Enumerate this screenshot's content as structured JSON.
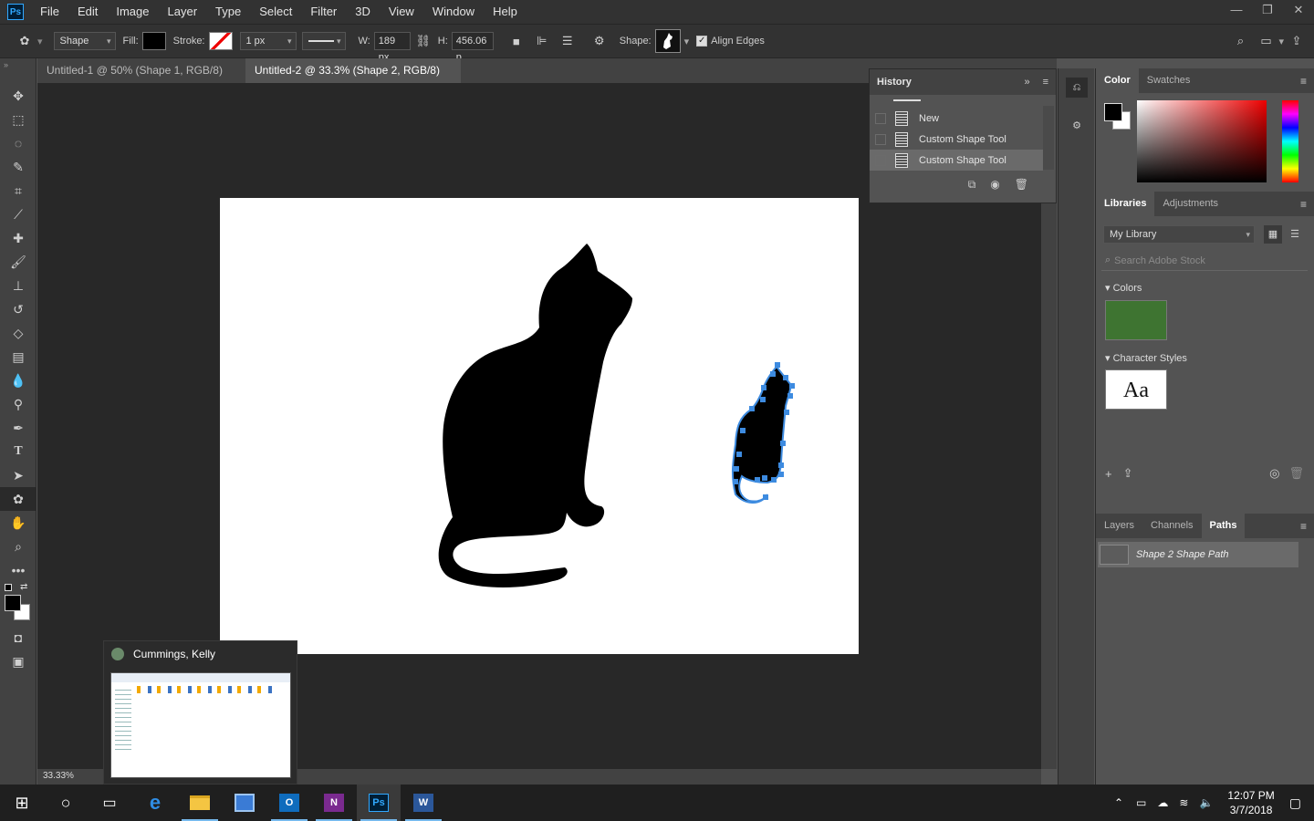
{
  "app": {
    "logo": "Ps"
  },
  "menu": [
    "File",
    "Edit",
    "Image",
    "Layer",
    "Type",
    "Select",
    "Filter",
    "3D",
    "View",
    "Window",
    "Help"
  ],
  "options": {
    "mode": "Shape",
    "fill_label": "Fill:",
    "stroke_label": "Stroke:",
    "stroke_width": "1 px",
    "w_label": "W:",
    "w_value": "189 px",
    "h_label": "H:",
    "h_value": "456.06 p",
    "shape_label": "Shape:",
    "align_edges": "Align Edges"
  },
  "tabs": [
    {
      "label": "Untitled-1 @ 50% (Shape 1, RGB/8) *"
    },
    {
      "label": "Untitled-2 @ 33.3% (Shape 2, RGB/8) *"
    }
  ],
  "history": {
    "title": "History",
    "items": [
      "New",
      "Custom Shape Tool",
      "Custom Shape Tool"
    ]
  },
  "color_panel": {
    "tabs": [
      "Color",
      "Swatches"
    ]
  },
  "libraries": {
    "tabs": [
      "Libraries",
      "Adjustments"
    ],
    "library_name": "My Library",
    "search_placeholder": "Search Adobe Stock",
    "colors_label": "Colors",
    "color_swatch": "#3e7431",
    "char_styles_label": "Character Styles",
    "char_preview": "Aa"
  },
  "layers": {
    "tabs": [
      "Layers",
      "Channels",
      "Paths"
    ],
    "path_item": "Shape 2 Shape Path"
  },
  "status": {
    "zoom": "33.33%"
  },
  "thumbnail": {
    "title": "Cummings, Kelly"
  },
  "taskbar": {
    "time": "12:07 PM",
    "date": "3/7/2018"
  }
}
